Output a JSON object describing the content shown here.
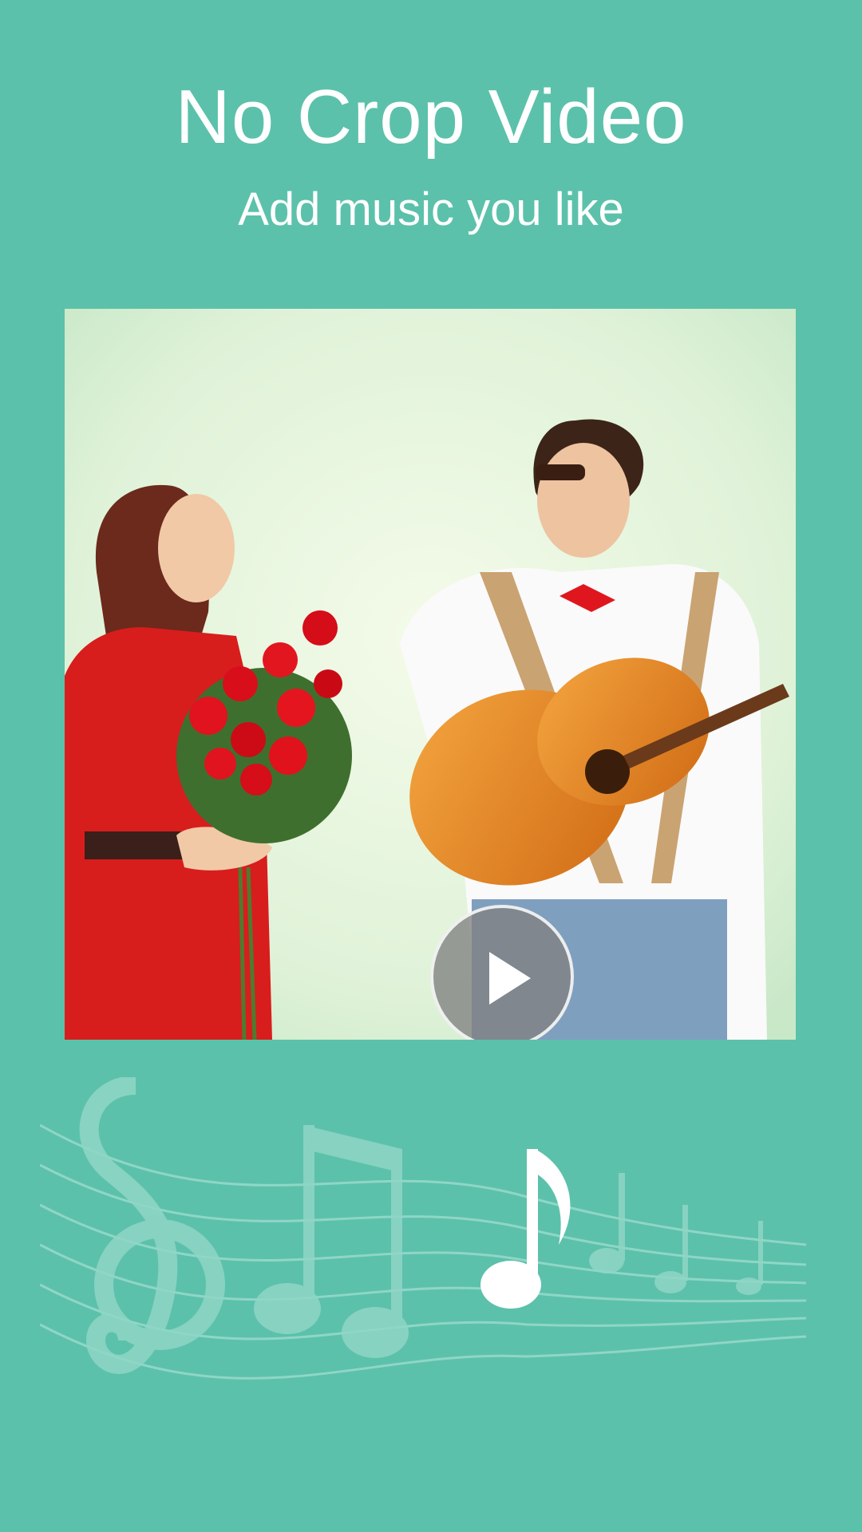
{
  "screen": {
    "title": "No Crop Video",
    "subtitle": "Add music you like",
    "background_color": "#5cc1aa"
  },
  "video_preview": {
    "play_icon": "play-icon",
    "play_button_color": "#808080"
  },
  "decoration": {
    "icon": "music-notes-icon",
    "staff_color": "#8fd6c6",
    "highlight_note_color": "#ffffff"
  }
}
